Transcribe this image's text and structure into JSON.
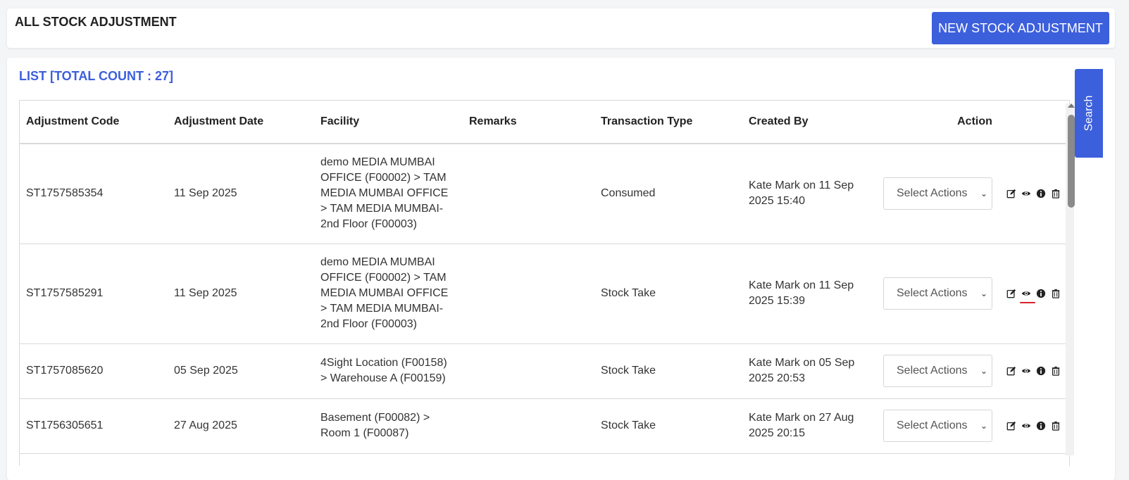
{
  "header": {
    "title": "ALL STOCK ADJUSTMENT",
    "new_button": "NEW STOCK ADJUSTMENT"
  },
  "list": {
    "title": "LIST [TOTAL COUNT : 27]"
  },
  "table": {
    "columns": [
      "Adjustment Code",
      "Adjustment Date",
      "Facility",
      "Remarks",
      "Transaction Type",
      "Created By",
      "Action"
    ],
    "rows": [
      {
        "code": "ST1757585354",
        "date": "11 Sep 2025",
        "facility": "demo MEDIA MUMBAI OFFICE (F00002) > TAM MEDIA MUMBAI OFFICE > TAM MEDIA MUMBAI- 2nd Floor (F00003)",
        "remarks": "",
        "type": "Consumed",
        "created_by": "Kate Mark on 11 Sep 2025 15:40",
        "action_select": "Select Actions"
      },
      {
        "code": "ST1757585291",
        "date": "11 Sep 2025",
        "facility": "demo MEDIA MUMBAI OFFICE (F00002) > TAM MEDIA MUMBAI OFFICE > TAM MEDIA MUMBAI- 2nd Floor (F00003)",
        "remarks": "",
        "type": "Stock Take",
        "created_by": "Kate Mark on 11 Sep 2025 15:39",
        "action_select": "Select Actions"
      },
      {
        "code": "ST1757085620",
        "date": "05 Sep 2025",
        "facility": "4Sight Location (F00158) > Warehouse A (F00159)",
        "remarks": "",
        "type": "Stock Take",
        "created_by": "Kate Mark on 05 Sep 2025 20:53",
        "action_select": "Select Actions"
      },
      {
        "code": "ST1756305651",
        "date": "27 Aug 2025",
        "facility": "Basement (F00082) > Room 1 (F00087)",
        "remarks": "",
        "type": "Stock Take",
        "created_by": "Kate Mark on 27 Aug 2025 20:15",
        "action_select": "Select Actions"
      }
    ]
  },
  "side_tab": {
    "label": "Search"
  },
  "icons": [
    "edit-icon",
    "eye-icon",
    "info-icon",
    "trash-icon"
  ],
  "colors": {
    "accent": "#3c5fdc",
    "highlight": "#d9232b"
  }
}
